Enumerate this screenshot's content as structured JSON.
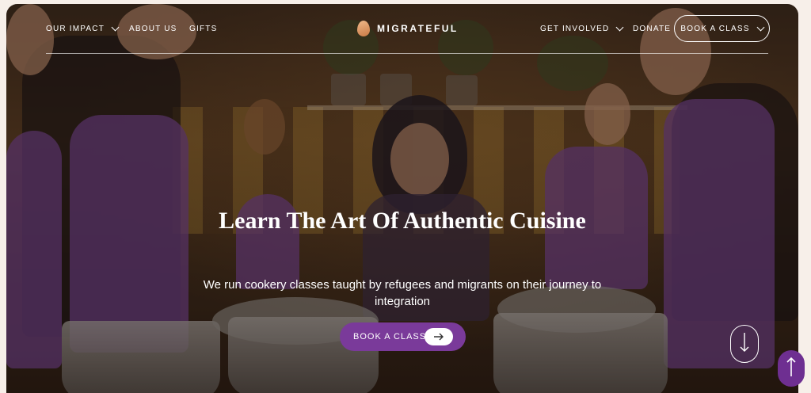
{
  "nav": {
    "left_links": [
      {
        "label": "OUR IMPACT",
        "has_dropdown": true
      },
      {
        "label": "ABOUT US",
        "has_dropdown": false
      },
      {
        "label": "GIFTS",
        "has_dropdown": false
      }
    ],
    "logo_text": "MIGRATEFUL",
    "right_links": [
      {
        "label": "GET INVOLVED",
        "has_dropdown": true
      },
      {
        "label": "DONATE",
        "has_dropdown": false
      }
    ],
    "book_button": {
      "label": "BOOK A CLASS",
      "has_dropdown": true
    }
  },
  "hero": {
    "headline": "Learn The Art Of Authentic Cuisine",
    "subline": "We run cookery classes taught by refugees and migrants on their journey to integration",
    "cta_label": "BOOK A CLASS",
    "cta_icon": "arrow-right-icon",
    "scroll_icon": "arrow-down-icon"
  },
  "floating": {
    "back_to_top_icon": "arrow-up-icon"
  },
  "colors": {
    "accent_purple": "#7a3a9a",
    "back_to_top": "#6e2f91",
    "page_bg": "#f7efe9"
  }
}
